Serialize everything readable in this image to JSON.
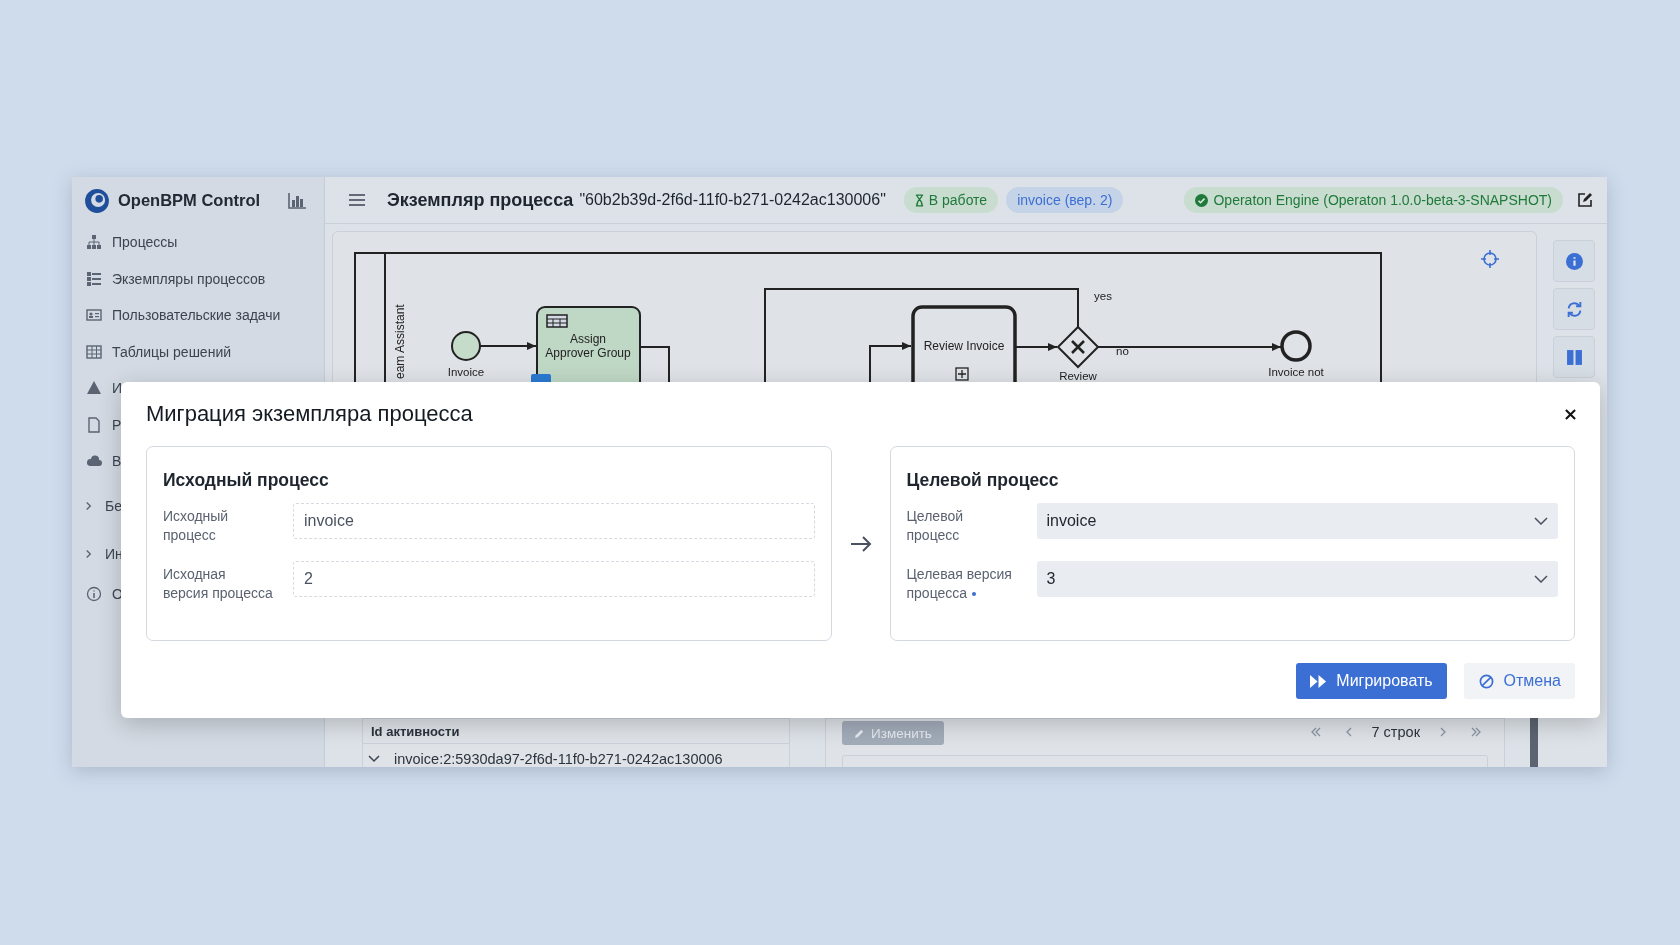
{
  "app": {
    "name": "OpenBPM Control"
  },
  "sidebar": {
    "items": [
      {
        "label": "Процессы",
        "kind": "link"
      },
      {
        "label": "Экземпляры процессов",
        "kind": "link"
      },
      {
        "label": "Пользовательские задачи",
        "kind": "link"
      },
      {
        "label": "Таблицы решений",
        "kind": "link"
      },
      {
        "label": "И",
        "kind": "link"
      },
      {
        "label": "Р",
        "kind": "link"
      },
      {
        "label": "В",
        "kind": "link"
      },
      {
        "label": "Бе",
        "kind": "group",
        "expanded": false
      },
      {
        "label": "Ин",
        "kind": "group",
        "expanded": false
      },
      {
        "label": "О",
        "kind": "link"
      }
    ]
  },
  "header": {
    "title": "Экземпляр процесса",
    "instance_id": "\"60b2b39d-2f6d-11f0-b271-0242ac130006\"",
    "badges": [
      {
        "label": "В работе",
        "kind": "state"
      },
      {
        "label": "invoice (вер. 2)",
        "kind": "version"
      }
    ],
    "engine": {
      "label": "Operaton Engine (Operaton 1.0.0-beta-3-SNAPSHOT)"
    }
  },
  "diagram": {
    "lane": "eam Assistant",
    "elements": [
      {
        "kind": "start",
        "lines": [
          "Invoice"
        ]
      },
      {
        "kind": "task",
        "lines": [
          "Assign",
          "Approver Group"
        ]
      },
      {
        "kind": "subprocess",
        "lines": [
          "Review Invoice"
        ]
      },
      {
        "kind": "gateway",
        "lines": [
          "Review"
        ]
      },
      {
        "kind": "end",
        "lines": [
          "Invoice not"
        ]
      }
    ],
    "flow_labels": [
      "yes",
      "no"
    ]
  },
  "lower": {
    "table": {
      "columns": [
        "Id активности"
      ],
      "rows": [
        {
          "text": "invoice:2:5930da97-2f6d-11f0-b271-0242ac130006",
          "expanded": true
        }
      ]
    },
    "edit_button": {
      "label": "Изменить",
      "disabled": true
    },
    "pagination": {
      "label": "7 строк"
    }
  },
  "modal": {
    "title": "Миграция экземпляра процесса",
    "panels": [
      {
        "heading": "Исходный процесс",
        "fields": [
          {
            "label_lines": [
              "Исходный",
              "процесс"
            ],
            "value": "invoice",
            "kind": "readonly",
            "required": false
          },
          {
            "label_lines": [
              "Исходная",
              "версия процесса"
            ],
            "value": "2",
            "kind": "readonly",
            "required": false
          }
        ]
      },
      {
        "heading": "Целевой процесс",
        "fields": [
          {
            "label_lines": [
              "Целевой",
              "процесс"
            ],
            "value": "invoice",
            "kind": "select",
            "required": false
          },
          {
            "label_lines": [
              "Целевая версия",
              "процесса"
            ],
            "value": "3",
            "kind": "select",
            "required": true
          }
        ]
      }
    ],
    "buttons": [
      {
        "label": "Мигрировать",
        "kind": "primary"
      },
      {
        "label": "Отмена",
        "kind": "cancel"
      }
    ]
  }
}
